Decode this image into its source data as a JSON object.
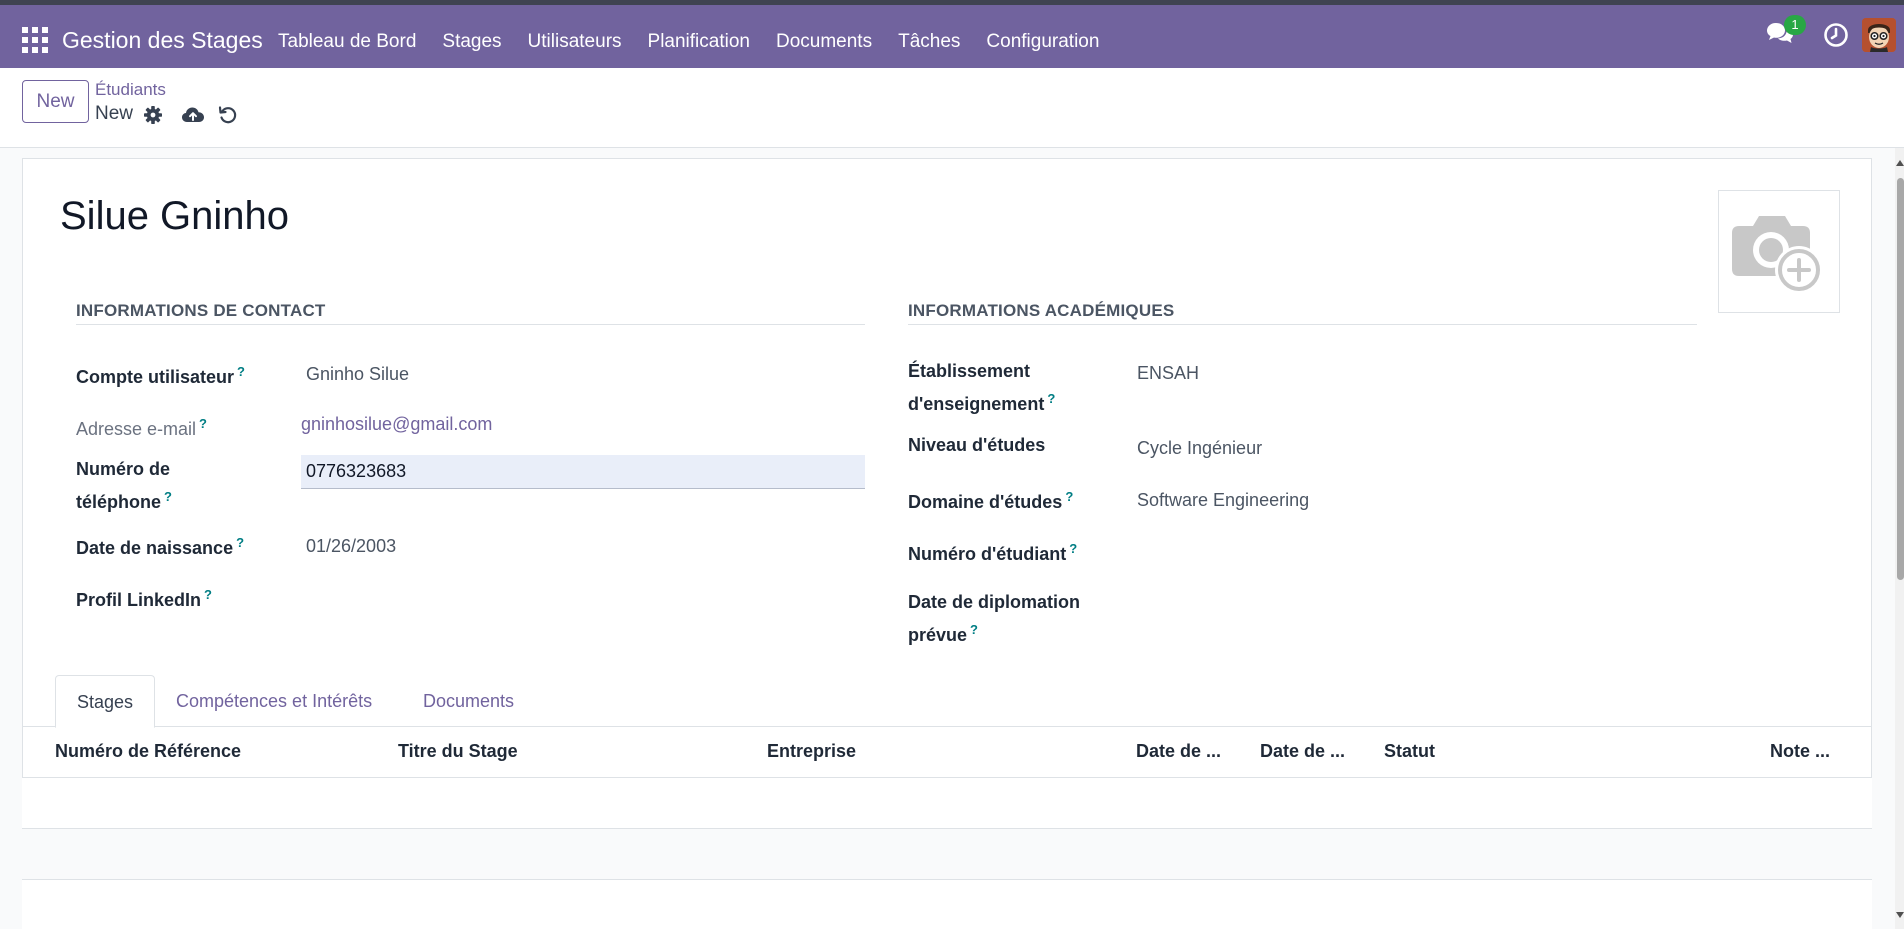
{
  "navbar": {
    "brand": "Gestion des Stages",
    "menu": [
      "Tableau de Bord",
      "Stages",
      "Utilisateurs",
      "Planification",
      "Documents",
      "Tâches",
      "Configuration"
    ],
    "chat_badge": "1",
    "color": "#71639e"
  },
  "control_panel": {
    "new_label": "New",
    "breadcrumb_parent": "Étudiants",
    "breadcrumb_current": "New"
  },
  "record": {
    "name": "Silue Gninho"
  },
  "contact": {
    "title": "INFORMATIONS DE CONTACT",
    "user_label": "Compte utilisateur",
    "user_value": "Gninho Silue",
    "email_label": "Adresse e-mail",
    "email_value": "gninhosilue@gmail.com",
    "phone_label_1": "Numéro de",
    "phone_label_2": "téléphone",
    "phone_value": "0776323683",
    "birth_label": "Date de naissance",
    "birth_value": "01/26/2003",
    "linkedin_label": "Profil LinkedIn"
  },
  "academic": {
    "title": "INFORMATIONS ACADÉMIQUES",
    "school_label_1": "Établissement",
    "school_label_2": "d'enseignement",
    "school_value": "ENSAH",
    "level_label": "Niveau d'études",
    "level_value": "Cycle Ingénieur",
    "domain_label": "Domaine d'études",
    "domain_value": "Software Engineering",
    "student_number_label": "Numéro d'étudiant",
    "graduation_label_1": "Date de diplomation",
    "graduation_label_2": "prévue"
  },
  "tabs": [
    "Stages",
    "Compétences et Intérêts",
    "Documents"
  ],
  "table": {
    "headers": [
      "Numéro de Référence",
      "Titre du Stage",
      "Entreprise",
      "Date de ...",
      "Date de ...",
      "Statut",
      "Note ..."
    ]
  },
  "help_mark": "?"
}
